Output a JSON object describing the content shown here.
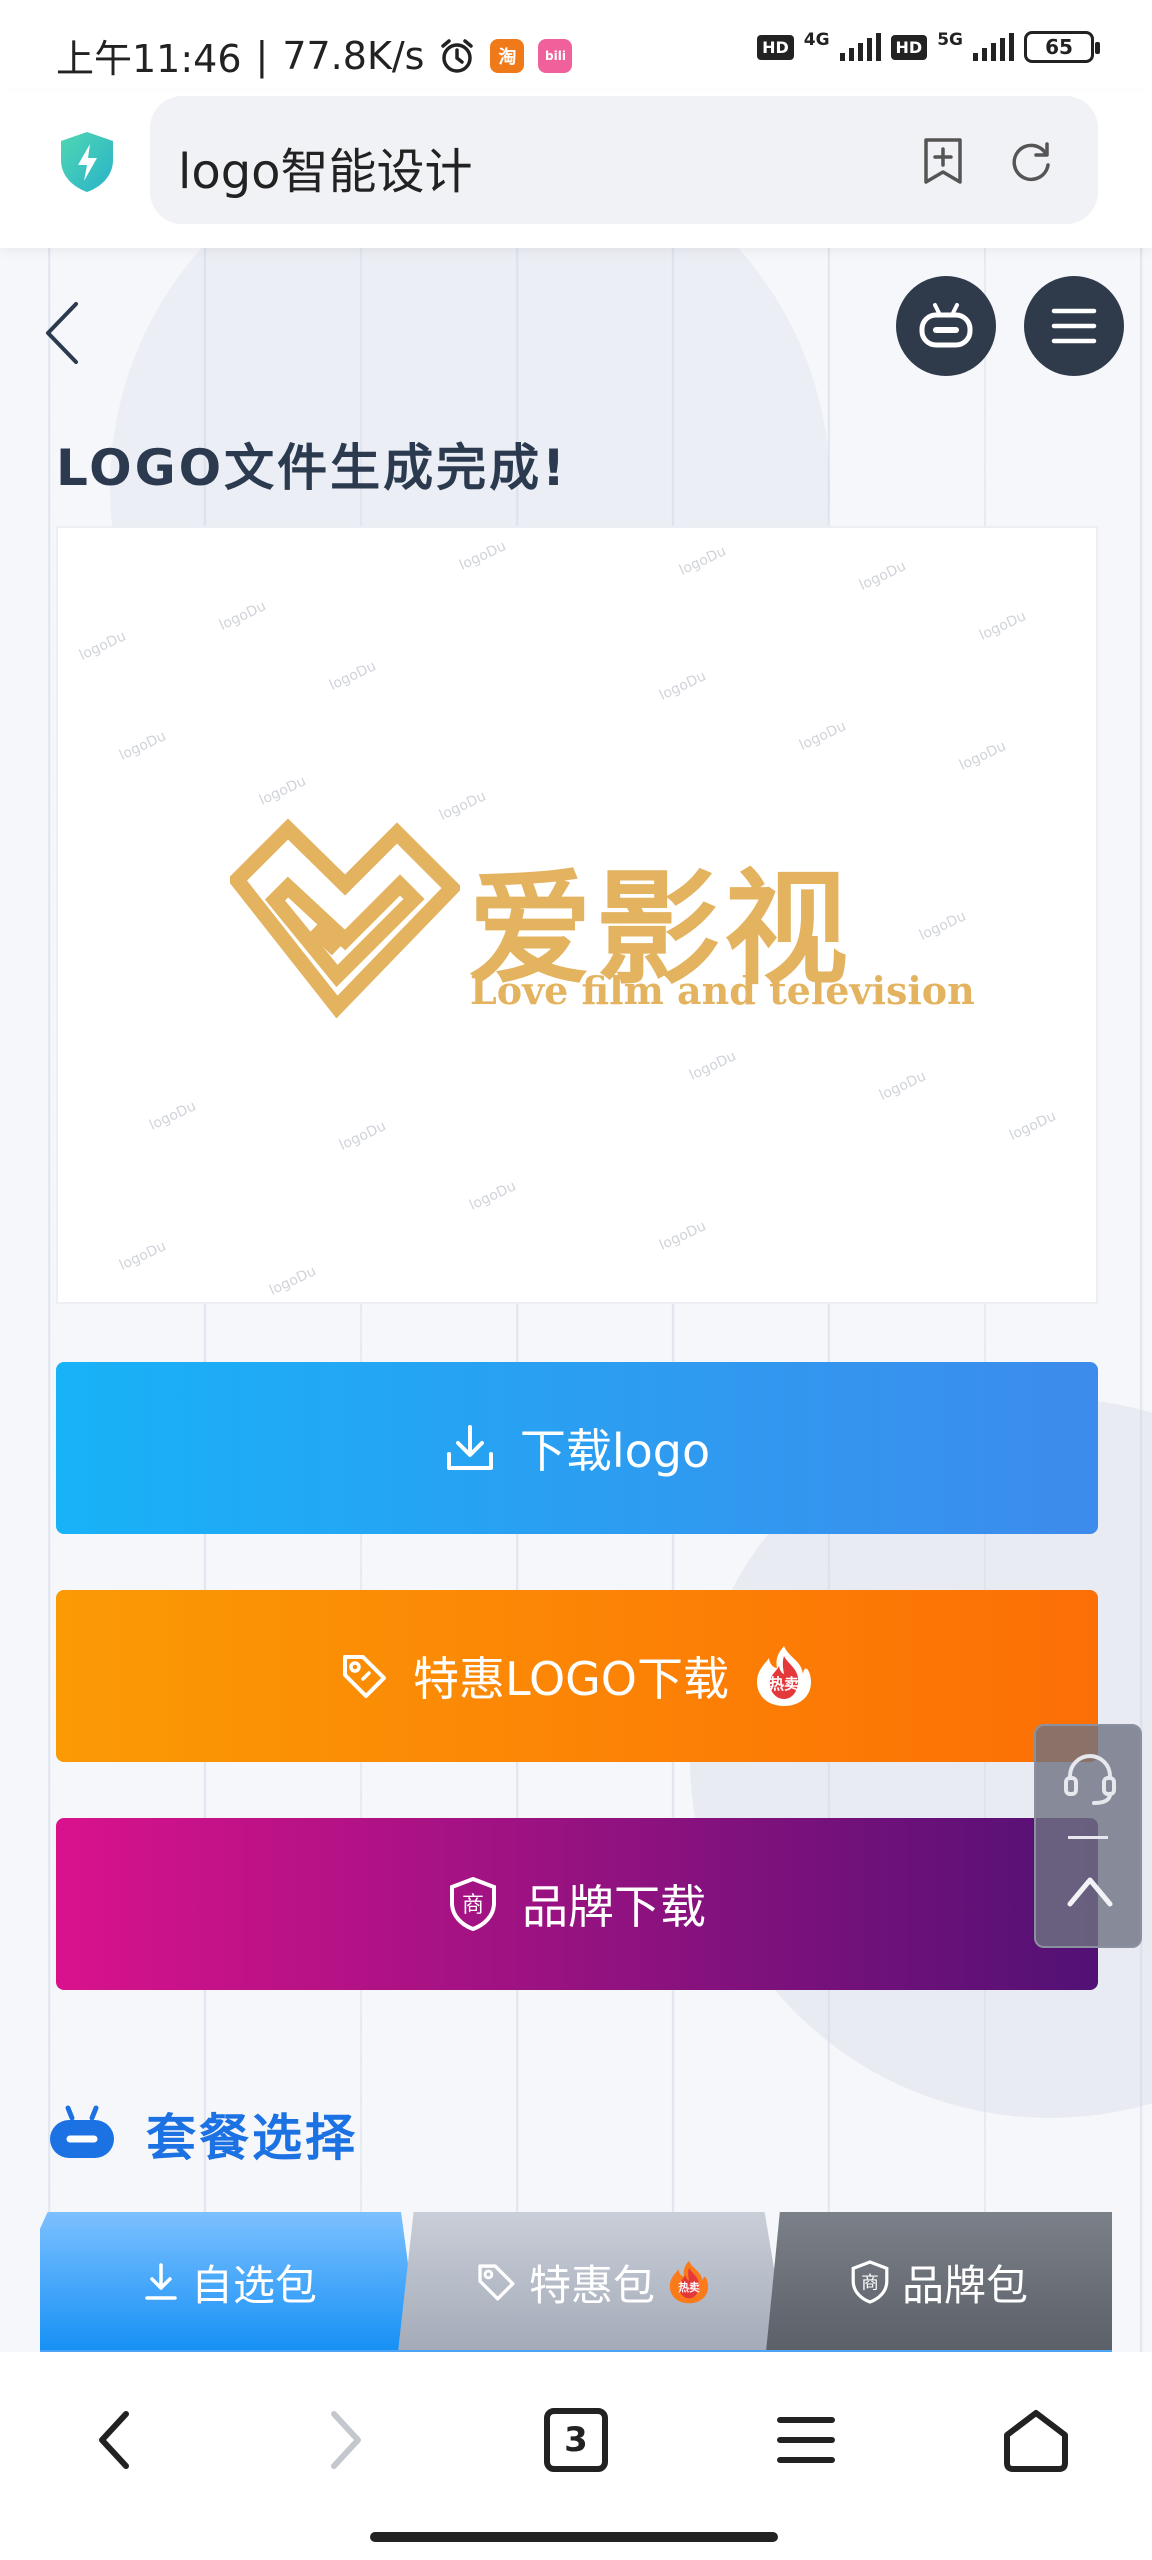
{
  "status_bar": {
    "time": "上午11:46",
    "speed": "77.8K/s",
    "hd1": "HD",
    "net1": "4G",
    "hd2": "HD",
    "net2": "5G",
    "battery": "65",
    "app_icon_1": "淘",
    "app_icon_2": "bili"
  },
  "browser": {
    "url_text": "logo智能设计",
    "icons": [
      "shield-lightning-icon",
      "add-bookmark-icon",
      "reload-icon"
    ]
  },
  "page": {
    "title": "LOGO文件生成完成!",
    "logo_preview": {
      "brand_name": "爱影视",
      "slogan": "Love film and television",
      "watermark": "logoDu",
      "brand_color": "#e3b35f"
    },
    "buttons": {
      "download": "下载logo",
      "special": "特惠LOGO下载",
      "special_badge": "热卖",
      "brand": "品牌下载",
      "brand_badge": "商"
    },
    "section_title": "套餐选择",
    "tabs": [
      {
        "label": "自选包"
      },
      {
        "label": "特惠包",
        "badge": "热卖"
      },
      {
        "label": "品牌包",
        "badge": "商"
      }
    ],
    "colors": {
      "download_start": "#18b2f7",
      "download_end": "#3d8bec",
      "special_start": "#fb9a05",
      "special_end": "#fc6f05",
      "brand_start": "#d9128c",
      "brand_end": "#521175",
      "section_title": "#1c72e3"
    }
  },
  "bottom_nav": {
    "tab_count": "3"
  }
}
